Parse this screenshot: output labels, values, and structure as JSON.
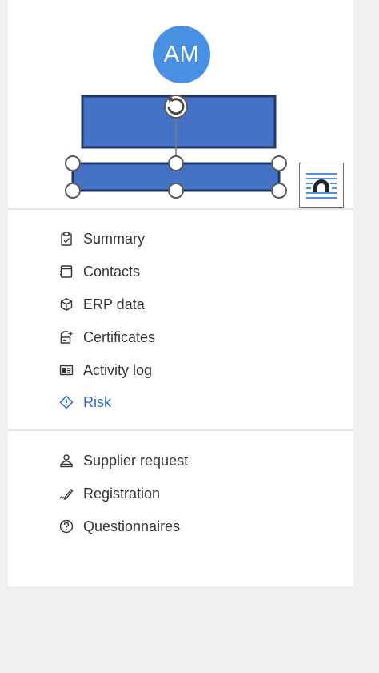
{
  "avatar": {
    "initials": "AM",
    "color": "#4a90e2"
  },
  "colors": {
    "shape_fill": "#4472c4",
    "shape_border": "#1f3864",
    "active_text": "#2e6bc6",
    "text": "#32363a"
  },
  "nav_primary": [
    {
      "label": "Summary",
      "icon": "clipboard-check-icon"
    },
    {
      "label": "Contacts",
      "icon": "address-book-icon"
    },
    {
      "label": "ERP data",
      "icon": "cube-icon"
    },
    {
      "label": "Certificates",
      "icon": "certificate-icon"
    },
    {
      "label": "Activity log",
      "icon": "id-card-icon"
    },
    {
      "label": "Risk",
      "icon": "risk-diamond-icon",
      "active": true
    }
  ],
  "nav_secondary": [
    {
      "label": "Supplier request",
      "icon": "supplier-person-icon"
    },
    {
      "label": "Registration",
      "icon": "pen-signature-icon"
    },
    {
      "label": "Questionnaires",
      "icon": "question-circle-icon"
    }
  ]
}
